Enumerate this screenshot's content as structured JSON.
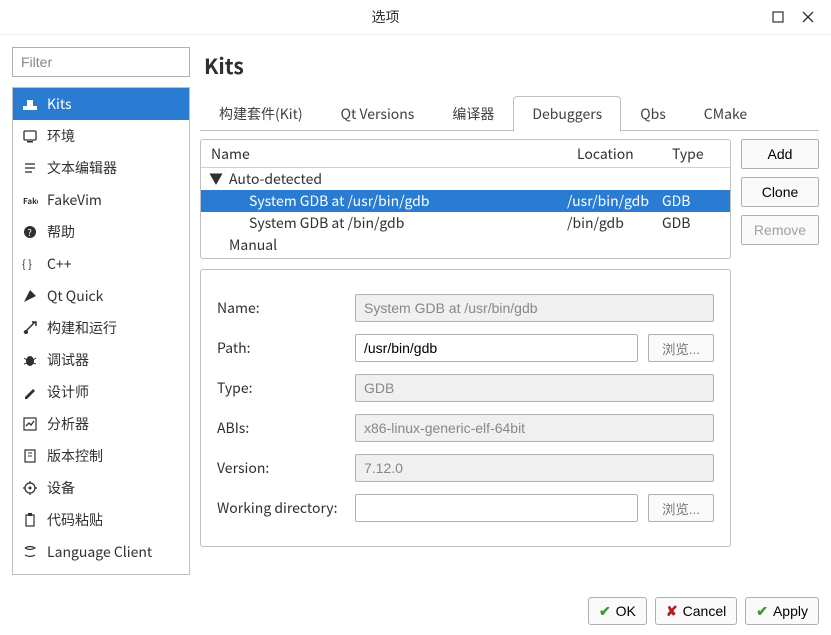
{
  "window": {
    "title": "选项"
  },
  "filter": {
    "placeholder": "Filter"
  },
  "categories": [
    {
      "icon": "kits",
      "label": "Kits",
      "selected": true
    },
    {
      "icon": "env",
      "label": "环境"
    },
    {
      "icon": "text",
      "label": "文本编辑器"
    },
    {
      "icon": "fakevim",
      "label": "FakeVim"
    },
    {
      "icon": "help",
      "label": "帮助"
    },
    {
      "icon": "cpp",
      "label": "C++"
    },
    {
      "icon": "qtquick",
      "label": "Qt Quick"
    },
    {
      "icon": "build",
      "label": "构建和运行"
    },
    {
      "icon": "debug",
      "label": "调试器"
    },
    {
      "icon": "design",
      "label": "设计师"
    },
    {
      "icon": "analyze",
      "label": "分析器"
    },
    {
      "icon": "vcs",
      "label": "版本控制"
    },
    {
      "icon": "device",
      "label": "设备"
    },
    {
      "icon": "paste",
      "label": "代码粘贴"
    },
    {
      "icon": "lang",
      "label": "Language Client"
    }
  ],
  "page": {
    "title": "Kits"
  },
  "tabs": [
    {
      "label": "构建套件(Kit)"
    },
    {
      "label": "Qt Versions"
    },
    {
      "label": "编译器"
    },
    {
      "label": "Debuggers",
      "active": true
    },
    {
      "label": "Qbs"
    },
    {
      "label": "CMake"
    }
  ],
  "list": {
    "headers": {
      "name": "Name",
      "location": "Location",
      "type": "Type"
    },
    "groups": [
      {
        "label": "Auto-detected",
        "expanded": true,
        "rows": [
          {
            "name": "System GDB at /usr/bin/gdb",
            "location": "/usr/bin/gdb",
            "type": "GDB",
            "selected": true
          },
          {
            "name": "System GDB at /bin/gdb",
            "location": "/bin/gdb",
            "type": "GDB"
          }
        ]
      },
      {
        "label": "Manual",
        "expanded": false,
        "rows": []
      }
    ]
  },
  "buttons": {
    "add": "Add",
    "clone": "Clone",
    "remove": "Remove"
  },
  "form": {
    "name_label": "Name:",
    "name_value": "System GDB at /usr/bin/gdb",
    "path_label": "Path:",
    "path_value": "/usr/bin/gdb",
    "browse": "浏览...",
    "type_label": "Type:",
    "type_value": "GDB",
    "abis_label": "ABIs:",
    "abis_value": "x86-linux-generic-elf-64bit",
    "version_label": "Version:",
    "version_value": "7.12.0",
    "wd_label": "Working directory:",
    "wd_value": ""
  },
  "dialog_buttons": {
    "ok": "OK",
    "cancel": "Cancel",
    "apply": "Apply"
  }
}
